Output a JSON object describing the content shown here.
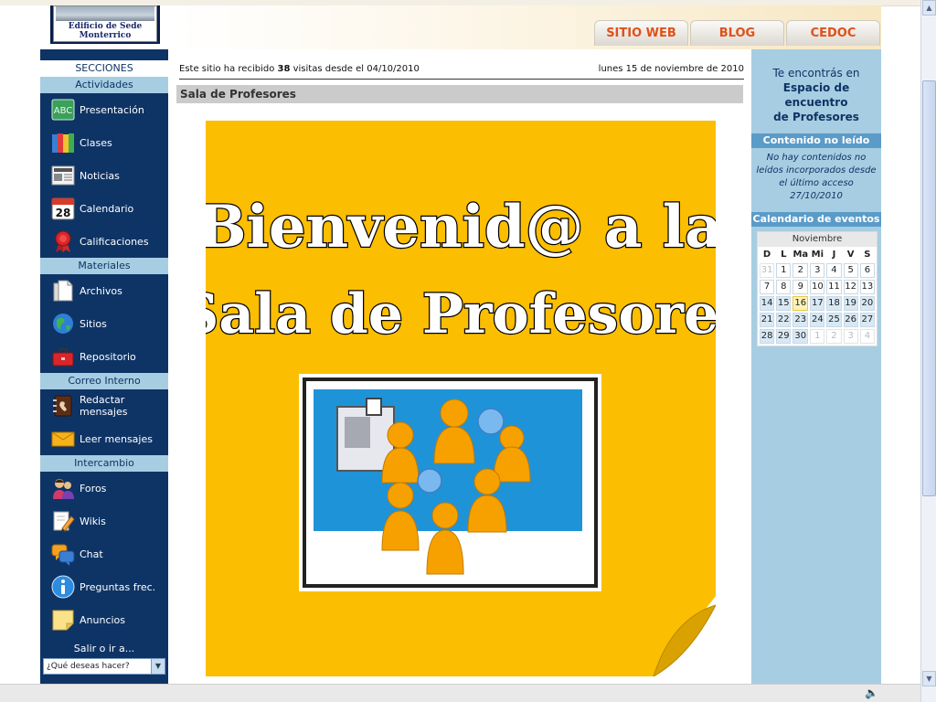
{
  "header": {
    "logo_text_line1": "Edificio de Sede",
    "logo_text_line2": "Monterrico",
    "tabs": [
      "SITIO WEB",
      "BLOG",
      "CEDOC"
    ]
  },
  "sidebar": {
    "title": "SECCIONES",
    "groups": [
      {
        "title": "Actividades",
        "items": [
          {
            "label": "Presentación",
            "icon": "abc-icon"
          },
          {
            "label": "Clases",
            "icon": "binders-icon"
          },
          {
            "label": "Noticias",
            "icon": "newspaper-icon"
          },
          {
            "label": "Calendario",
            "icon": "calendar-icon",
            "icon_text": "28"
          },
          {
            "label": "Calificaciones",
            "icon": "ribbon-icon"
          }
        ]
      },
      {
        "title": "Materiales",
        "items": [
          {
            "label": "Archivos",
            "icon": "files-icon"
          },
          {
            "label": "Sitios",
            "icon": "globe-icon"
          },
          {
            "label": "Repositorio",
            "icon": "toolbox-icon"
          }
        ]
      },
      {
        "title": "Correo Interno",
        "items": [
          {
            "label": "Redactar mensajes",
            "icon": "address-book-icon"
          },
          {
            "label": "Leer mensajes",
            "icon": "envelope-icon"
          }
        ]
      },
      {
        "title": "Intercambio",
        "items": [
          {
            "label": "Foros",
            "icon": "people-icon"
          },
          {
            "label": "Wikis",
            "icon": "pencil-icon"
          },
          {
            "label": "Chat",
            "icon": "chat-icon"
          },
          {
            "label": "Preguntas frec.",
            "icon": "info-icon"
          },
          {
            "label": "Anuncios",
            "icon": "sticky-note-icon"
          }
        ]
      }
    ],
    "exit_label": "Salir o ir a...",
    "select_value": "¿Qué deseas hacer?"
  },
  "main": {
    "visits_prefix": "Este sitio ha recibido ",
    "visits_count": "38",
    "visits_suffix": " visitas desde el 04/10/2010",
    "date": "lunes 15 de noviembre de 2010",
    "page_title": "Sala de Profesores",
    "welcome_line1": "Bienvenid@ a la",
    "welcome_line2": "Sala de Profesores"
  },
  "rightbar": {
    "you_are": "Te encontrás en",
    "space_name_line1": "Espacio de encuentro",
    "space_name_line2": "de Profesores",
    "unread_title": "Contenido no leído",
    "unread_text": "No hay contenidos no leídos incorporados desde el último acceso 27/10/2010",
    "calendar_title": "Calendario de eventos",
    "calendar": {
      "month": "Noviembre",
      "weekdays": [
        "D",
        "L",
        "Ma",
        "Mi",
        "J",
        "V",
        "S"
      ],
      "weeks": [
        [
          "31",
          "1",
          "2",
          "3",
          "4",
          "5",
          "6"
        ],
        [
          "7",
          "8",
          "9",
          "10",
          "11",
          "12",
          "13"
        ],
        [
          "14",
          "15",
          "16",
          "17",
          "18",
          "19",
          "20"
        ],
        [
          "21",
          "22",
          "23",
          "24",
          "25",
          "26",
          "27"
        ],
        [
          "28",
          "29",
          "30",
          "1",
          "2",
          "3",
          "4"
        ]
      ]
    }
  },
  "colors": {
    "sidebar_bg": "#0e3466",
    "section_bg": "#a7cde2",
    "tab_text": "#e0501a",
    "note_bg": "#fbbe00"
  }
}
